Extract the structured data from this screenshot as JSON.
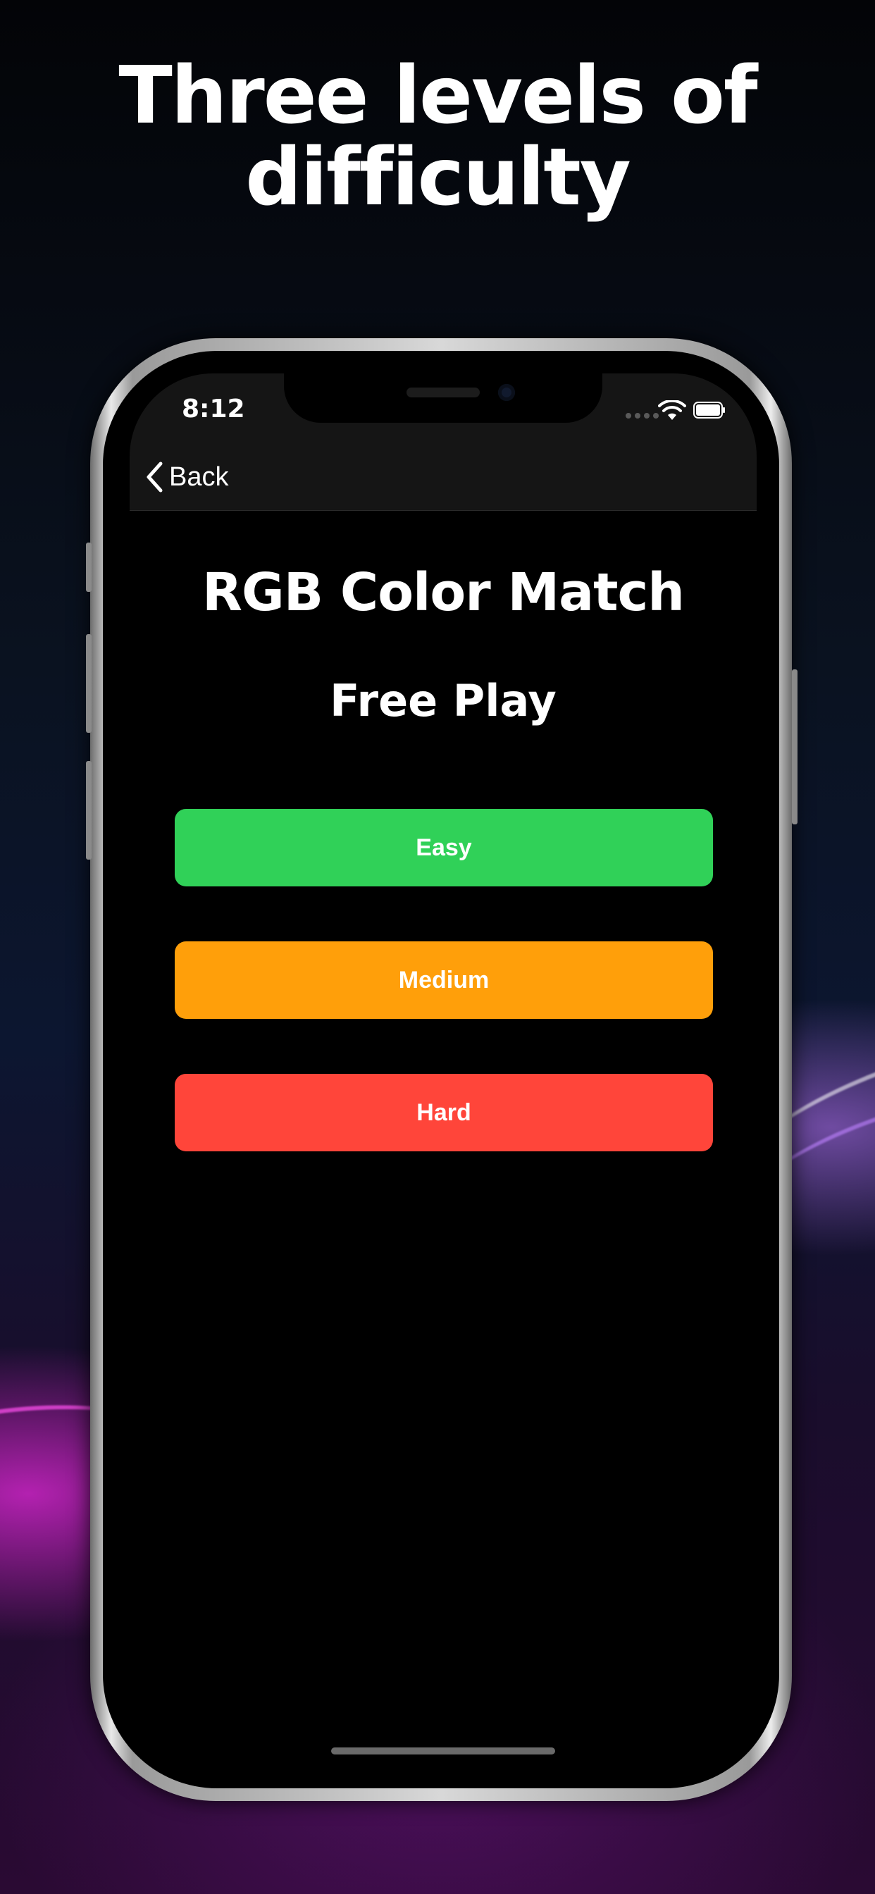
{
  "headline": {
    "line1": "Three levels of",
    "line2": "difficulty"
  },
  "status_bar": {
    "time": "8:12",
    "icons": [
      "cellular-signal-icon",
      "wifi-icon",
      "battery-icon"
    ]
  },
  "nav": {
    "back_label": "Back",
    "back_icon": "chevron-left-icon"
  },
  "screen": {
    "app_title": "RGB Color Match",
    "mode_title": "Free Play",
    "levels": [
      {
        "label": "Easy",
        "color": "#30D158"
      },
      {
        "label": "Medium",
        "color": "#FF9F0A"
      },
      {
        "label": "Hard",
        "color": "#FF453A"
      }
    ]
  }
}
